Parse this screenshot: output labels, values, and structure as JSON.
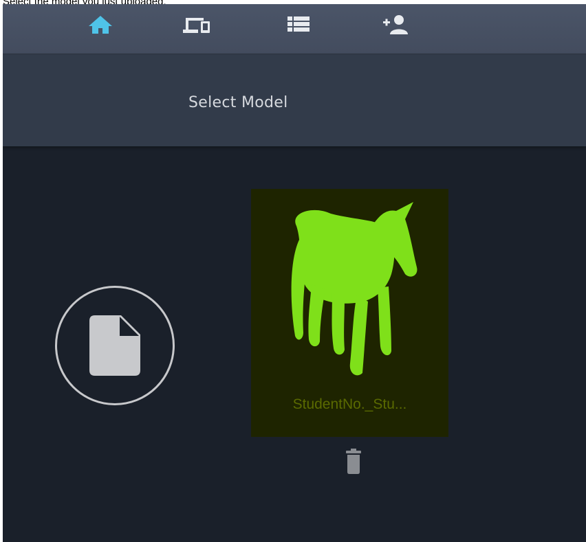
{
  "caption": "Select the model you just uploaded.",
  "nav": {
    "items": [
      {
        "icon": "home-icon",
        "active": true
      },
      {
        "icon": "devices-icon",
        "active": false
      },
      {
        "icon": "list-icon",
        "active": false
      },
      {
        "icon": "add-user-icon",
        "active": false
      }
    ]
  },
  "header": {
    "title": "Select Model"
  },
  "upload": {
    "icon": "file-icon"
  },
  "models": [
    {
      "name": "StudentNo._Stu..."
    }
  ],
  "colors": {
    "active_nav": "#4fc3e8",
    "inactive_nav": "#e8ebef",
    "model_green": "#7fe01a"
  }
}
